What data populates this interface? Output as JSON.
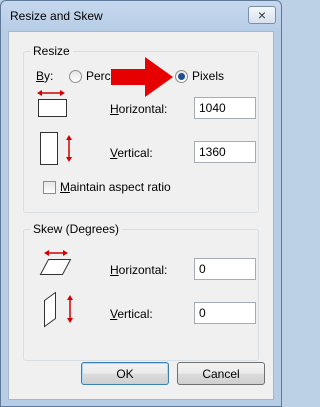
{
  "window": {
    "title": "Resize and Skew",
    "close_glyph": "×"
  },
  "resize": {
    "group_title": "Resize",
    "by_label_prefix": "B",
    "by_label_rest": "y:",
    "percentage_label": "Perce",
    "pixels_label": "Pixels",
    "selected": "pixels",
    "horizontal_label_u": "H",
    "horizontal_label_rest": "orizontal:",
    "horizontal_value": "1040",
    "vertical_label_u": "V",
    "vertical_label_rest": "ertical:",
    "vertical_value": "1360",
    "maintain_label_u": "M",
    "maintain_label_rest": "aintain aspect ratio",
    "maintain_checked": false
  },
  "skew": {
    "group_title": "Skew (Degrees)",
    "horizontal_label_u": "H",
    "horizontal_label_rest": "orizontal:",
    "horizontal_value": "0",
    "vertical_label_u": "V",
    "vertical_label_rest": "ertical:",
    "vertical_value": "0"
  },
  "buttons": {
    "ok": "OK",
    "cancel": "Cancel"
  },
  "colors": {
    "annotation_arrow": "#e60000",
    "resize_arrow": "#d40000",
    "accent": "#1c4f8f"
  },
  "icons": [
    "resize-horizontal-icon",
    "resize-vertical-icon",
    "skew-horizontal-icon",
    "skew-vertical-icon",
    "red-arrow-annotation"
  ]
}
